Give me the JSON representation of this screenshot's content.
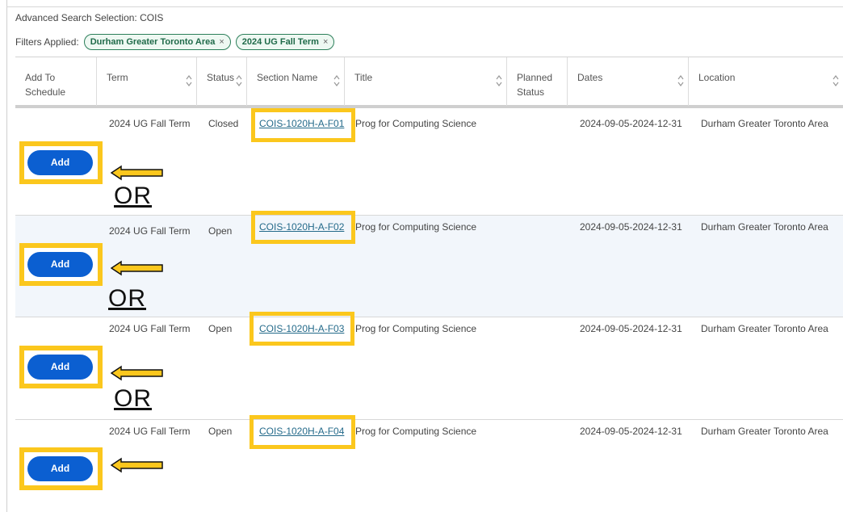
{
  "page": {
    "heading": "Advanced Search Selection: COIS",
    "filters_label": "Filters Applied:",
    "filters": [
      {
        "label": "Durham Greater Toronto Area",
        "remove": "×"
      },
      {
        "label": "2024 UG Fall Term",
        "remove": "×"
      }
    ]
  },
  "columns": {
    "add_to_schedule": "Add To Schedule",
    "term": "Term",
    "status": "Status",
    "section_name": "Section Name",
    "title": "Title",
    "planned_status": "Planned Status",
    "dates": "Dates",
    "location": "Location"
  },
  "rows": [
    {
      "term": "2024 UG Fall Term",
      "status": "Closed",
      "section": "COIS-1020H-A-F01",
      "title": "Prog for Computing Science",
      "planned_status": "",
      "dates": "2024-09-05-2024-12-31",
      "location": "Durham Greater Toronto Area",
      "add_label": "Add",
      "annotation": "OR"
    },
    {
      "term": "2024 UG Fall Term",
      "status": "Open",
      "section": "COIS-1020H-A-F02",
      "title": "Prog for Computing Science",
      "planned_status": "",
      "dates": "2024-09-05-2024-12-31",
      "location": "Durham Greater Toronto Area",
      "add_label": "Add",
      "annotation": "OR"
    },
    {
      "term": "2024 UG Fall Term",
      "status": "Open",
      "section": "COIS-1020H-A-F03",
      "title": "Prog for Computing Science",
      "planned_status": "",
      "dates": "2024-09-05-2024-12-31",
      "location": "Durham Greater Toronto Area",
      "add_label": "Add",
      "annotation": "OR"
    },
    {
      "term": "2024 UG Fall Term",
      "status": "Open",
      "section": "COIS-1020H-A-F04",
      "title": "Prog for Computing Science",
      "planned_status": "",
      "dates": "2024-09-05-2024-12-31",
      "location": "Durham Greater Toronto Area",
      "add_label": "Add",
      "annotation": ""
    }
  ],
  "colors": {
    "highlight": "#fbc71d",
    "add_button": "#0b5fd1",
    "chip_border": "#2c7f5a",
    "link": "#246a8a",
    "alt_row": "#f2f6fb"
  },
  "icons": {
    "sort": "sort-arrows-icon",
    "remove_filter": "close-icon",
    "annotation_arrow": "left-arrow-icon"
  }
}
